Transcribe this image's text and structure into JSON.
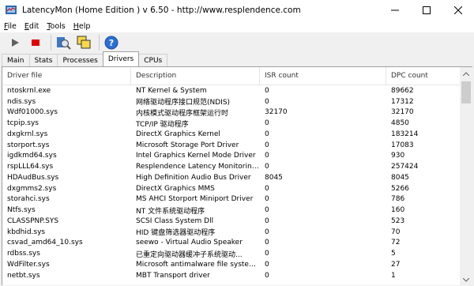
{
  "window": {
    "title": "LatencyMon  (Home Edition )  v 6.50 - http://www.resplendence.com"
  },
  "menu": [
    {
      "ul": "F",
      "rest": "ile"
    },
    {
      "ul": "E",
      "rest": "dit"
    },
    {
      "ul": "T",
      "rest": "ools"
    },
    {
      "ul": "H",
      "rest": "elp"
    }
  ],
  "toolbar": {
    "icons": [
      "play-icon",
      "stop-icon",
      "analysis-icon",
      "windows-icon",
      "help-icon"
    ]
  },
  "tabs": [
    "Main",
    "Stats",
    "Processes",
    "Drivers",
    "CPUs"
  ],
  "active_tab": "Drivers",
  "table": {
    "columns": [
      "Driver file",
      "Description",
      "ISR count",
      "DPC count"
    ],
    "rows": [
      [
        "ntoskrnl.exe",
        "NT Kernel & System",
        "0",
        "89662"
      ],
      [
        "ndis.sys",
        "网络驱动程序接口规范(NDIS)",
        "0",
        "17312"
      ],
      [
        "Wdf01000.sys",
        "内核模式驱动程序框架运行时",
        "32170",
        "32170"
      ],
      [
        "tcpip.sys",
        "TCP/IP 驱动程序",
        "0",
        "4850"
      ],
      [
        "dxgkrnl.sys",
        "DirectX Graphics Kernel",
        "0",
        "183214"
      ],
      [
        "storport.sys",
        "Microsoft Storage Port Driver",
        "0",
        "17083"
      ],
      [
        "igdkmd64.sys",
        "Intel Graphics Kernel Mode Driver",
        "0",
        "930"
      ],
      [
        "rspLLL64.sys",
        "Resplendence Latency Monitoring a...",
        "0",
        "257424"
      ],
      [
        "HDAudBus.sys",
        "High Definition Audio Bus Driver",
        "8045",
        "8045"
      ],
      [
        "dxgmms2.sys",
        "DirectX Graphics MMS",
        "0",
        "5266"
      ],
      [
        "storahci.sys",
        "MS AHCI Storport Miniport Driver",
        "0",
        "786"
      ],
      [
        "Ntfs.sys",
        "NT 文件系统驱动程序",
        "0",
        "160"
      ],
      [
        "CLASSPNP.SYS",
        "SCSI Class System Dll",
        "0",
        "523"
      ],
      [
        "kbdhid.sys",
        "HID 键盘筛选器驱动程序",
        "0",
        "70"
      ],
      [
        "csvad_amd64_10.sys",
        "seewo - Virtual Audio Speaker",
        "0",
        "72"
      ],
      [
        "rdbss.sys",
        "已重定向驱动器缓冲子系统驱动...",
        "0",
        "5"
      ],
      [
        "WdFilter.sys",
        "Microsoft antimalware file system filt...",
        "0",
        "27"
      ],
      [
        "netbt.sys",
        "MBT Transport driver",
        "0",
        "1"
      ]
    ]
  }
}
